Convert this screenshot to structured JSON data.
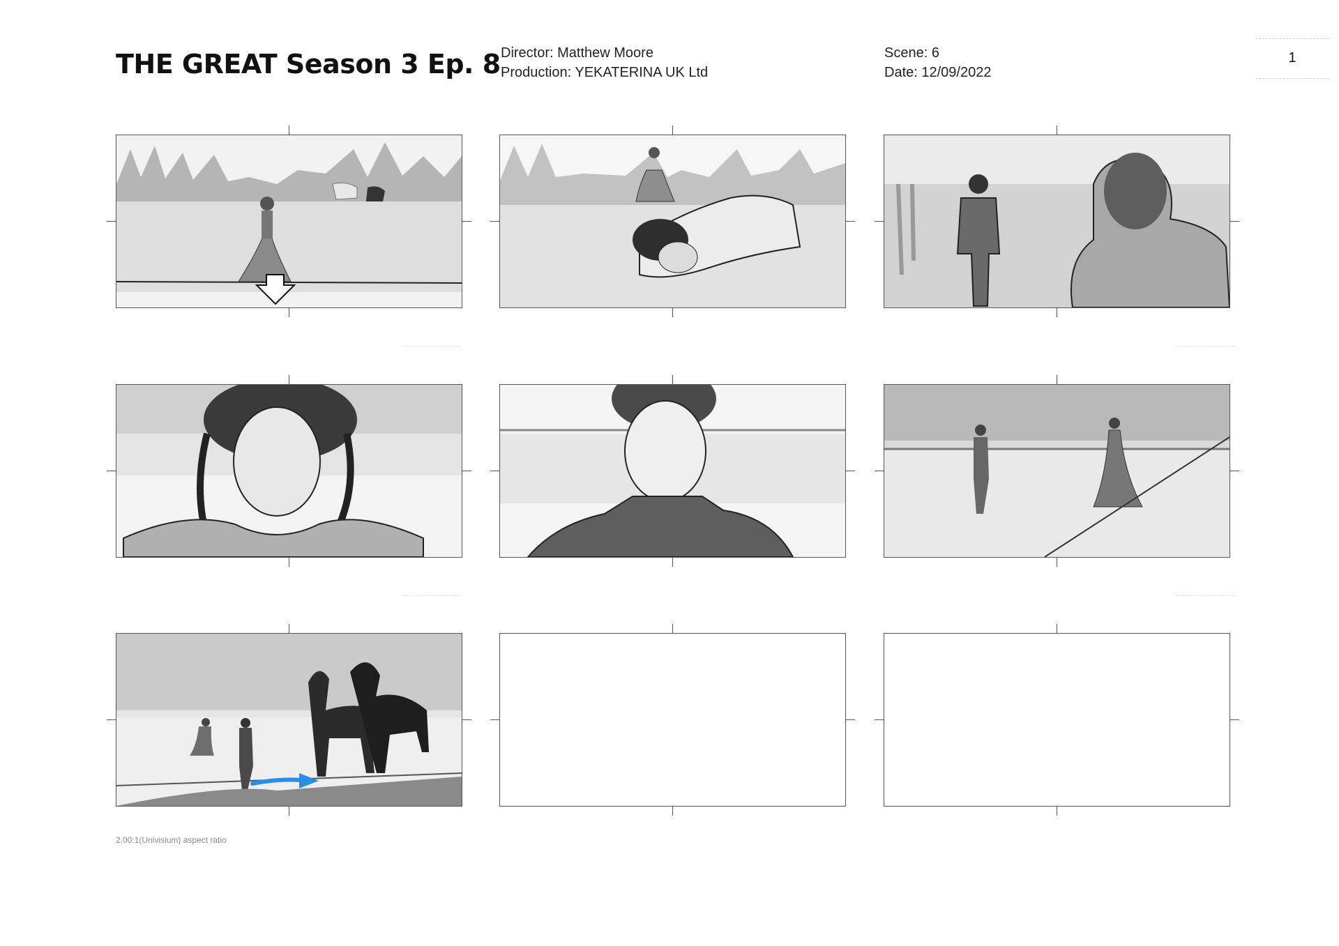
{
  "header": {
    "title": "THE GREAT Season 3 Ep. 8",
    "director": "Director: Matthew Moore",
    "production": "Production: YEKATERINA UK Ltd",
    "scene": "Scene: 6",
    "date": "Date: 12/09/2022",
    "page_number": "1"
  },
  "panels": [
    {
      "name": "woman-in-gown-meadow-horses"
    },
    {
      "name": "man-bowing-before-woman"
    },
    {
      "name": "man-walking-toward-woman"
    },
    {
      "name": "woman-closeup-portrait"
    },
    {
      "name": "man-closeup-portrait"
    },
    {
      "name": "couple-on-wet-plain"
    },
    {
      "name": "man-walking-to-horses"
    },
    {
      "name": "empty-panel"
    },
    {
      "name": "empty-panel"
    }
  ],
  "footer": {
    "aspect_ratio_caption": "2.00:1(Univisium) aspect ratio"
  },
  "colors": {
    "motion_arrow": "#2a8ee8",
    "sketch_ink": "#222222",
    "wash_gray": "#9a9a9a"
  }
}
